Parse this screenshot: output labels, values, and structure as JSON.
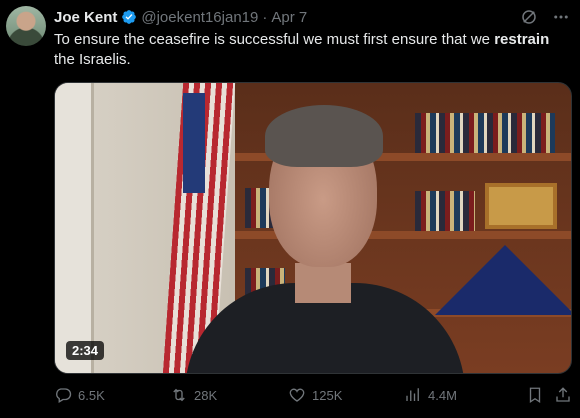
{
  "tweet": {
    "author_name": "Joe Kent",
    "handle": "@joekent16jan19",
    "separator": "·",
    "date": "Apr 7",
    "text_before": "To ensure the ceasefire is successful we must first ensure that we ",
    "text_bold": "restrain",
    "text_after": " the Israelis."
  },
  "media": {
    "duration": "2:34"
  },
  "actions": {
    "replies": "6.5K",
    "reposts": "28K",
    "likes": "125K",
    "views": "4.4M"
  },
  "colors": {
    "verified": "#1d9bf0",
    "muted": "#71767b",
    "text": "#e7e9ea",
    "background": "#000000"
  },
  "icons": [
    "verified-badge-icon",
    "grok-icon",
    "more-icon",
    "reply-icon",
    "repost-icon",
    "like-icon",
    "views-icon",
    "bookmark-icon",
    "share-icon"
  ]
}
